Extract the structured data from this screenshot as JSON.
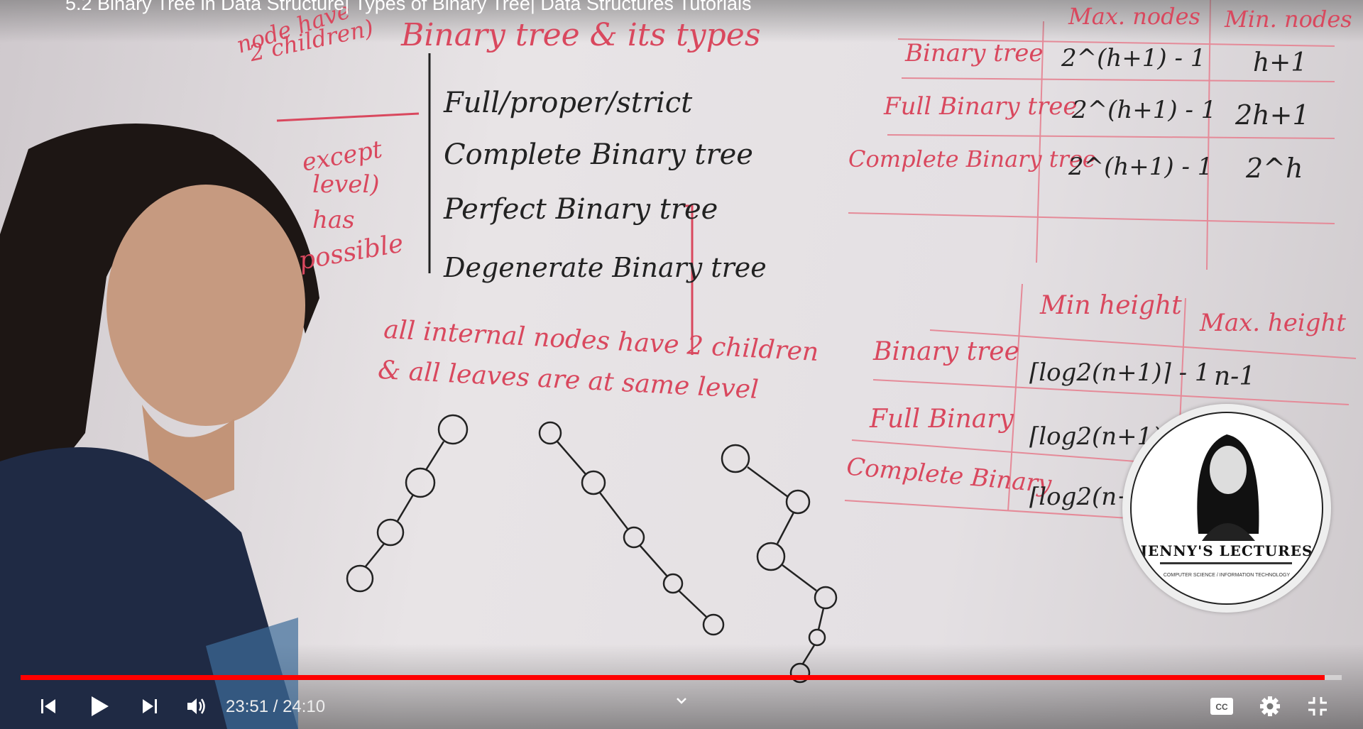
{
  "video": {
    "title": "5.2 Binary Tree in Data Structure| Types of Binary Tree| Data Structures Tutorials",
    "current_time": "23:51",
    "duration": "24:10",
    "time_display": "23:51 / 24:10",
    "progress_fraction": 0.987,
    "accent_color": "#ff0000"
  },
  "whiteboard": {
    "heading": "Binary tree & its types",
    "types": [
      "Full/proper/strict",
      "Complete Binary tree",
      "Perfect Binary tree",
      "Degenerate Binary tree"
    ],
    "left_notes": [
      "node have",
      "2 children)",
      "except",
      "level)",
      "has",
      "possible"
    ],
    "perfect_definition": [
      "all internal nodes have 2 children",
      "& all leaves are at same level"
    ],
    "table1": {
      "headers": [
        "Max. nodes",
        "Min. nodes"
      ],
      "rows": [
        [
          "Binary tree",
          "2^(h+1) - 1",
          "h+1"
        ],
        [
          "Full Binary tree",
          "2^(h+1) - 1",
          "2h+1"
        ],
        [
          "Complete Binary tree",
          "2^(h+1) - 1",
          "2^h"
        ]
      ]
    },
    "table2": {
      "headers": [
        "Min height",
        "Max. height"
      ],
      "rows": [
        [
          "Binary tree",
          "⌈log2(n+1)⌉ - 1",
          "n-1"
        ],
        [
          "Full Binary",
          "⌈log2(n+1)⌉",
          ""
        ],
        [
          "Complete Binary",
          "⌈log2(n+",
          ""
        ]
      ]
    }
  },
  "logo": {
    "name": "JENNY'S LECTURES",
    "subtitle": "COMPUTER SCIENCE / INFORMATION TECHNOLOGY"
  },
  "controls": {
    "icons": [
      "previous-icon",
      "play-icon",
      "next-icon",
      "volume-icon",
      "chevron-down-icon",
      "captions-icon",
      "settings-icon",
      "exit-fullscreen-icon"
    ]
  }
}
